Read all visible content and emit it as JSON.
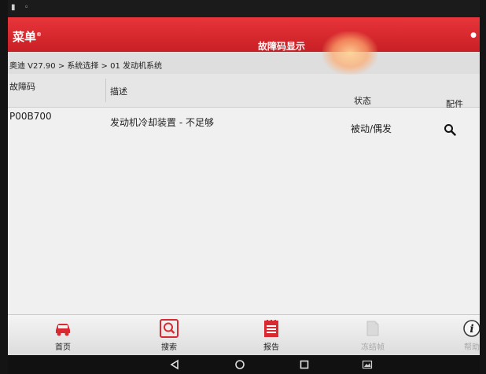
{
  "app": {
    "title": "菜单",
    "title_mark": "®",
    "page_title": "故障码显示"
  },
  "breadcrumb": "奥迪 V27.90 > 系统选择 > 01 发动机系统",
  "table": {
    "columns": [
      "故障码",
      "描述",
      "状态",
      "配件"
    ],
    "rows": [
      {
        "code": "P00B700",
        "description": "发动机冷却装置 - 不足够",
        "status": "被动/偶发",
        "parts_icon": "search-icon"
      }
    ]
  },
  "bottom_nav": [
    {
      "label": "首页",
      "icon": "car-home-icon",
      "enabled": true
    },
    {
      "label": "搜索",
      "icon": "search-icon",
      "enabled": true
    },
    {
      "label": "报告",
      "icon": "report-icon",
      "enabled": true
    },
    {
      "label": "冻结帧",
      "icon": "freeze-frame-icon",
      "enabled": false
    },
    {
      "label": "帮助",
      "icon": "help-icon",
      "enabled": false
    }
  ],
  "android_nav": [
    "back-icon",
    "home-icon",
    "recents-icon",
    "screenshot-icon"
  ],
  "colors": {
    "accent_red": "#d82a30",
    "background": "#ececec",
    "disabled_text": "#a8a8a8"
  }
}
